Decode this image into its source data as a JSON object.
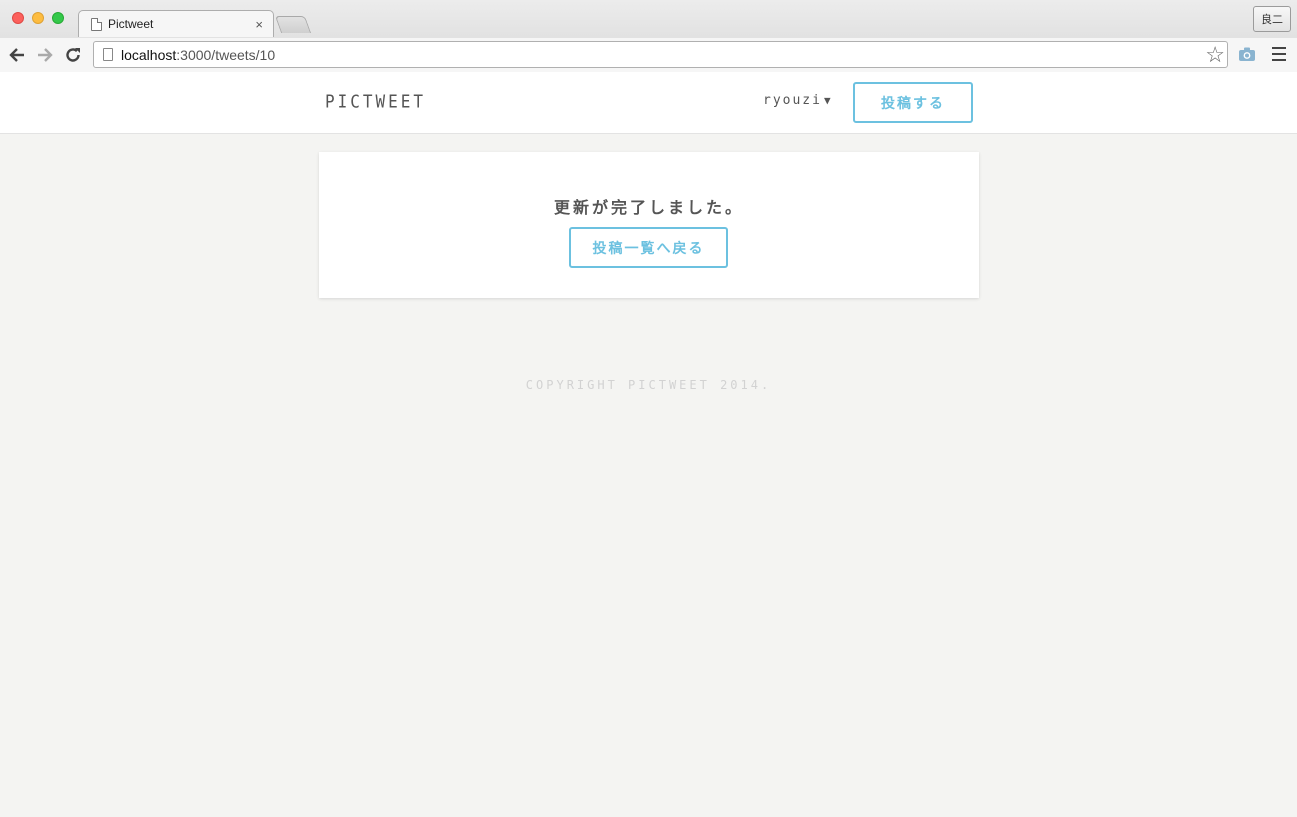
{
  "browser": {
    "tab_title": "Pictweet",
    "tab_close": "×",
    "profile_name": "良二",
    "url_host": "localhost",
    "url_path": ":3000/tweets/10"
  },
  "header": {
    "logo": "PICTWEET",
    "user_name": "ryouzi",
    "user_caret": "▼",
    "post_label": "投稿する"
  },
  "notice": {
    "message": "更新が完了しました。",
    "back_label": "投稿一覧へ戻る"
  },
  "footer": {
    "copyright": "COPYRIGHT PICTWEET 2014."
  },
  "colors": {
    "accent": "#6cc1e0",
    "page_bg": "#f4f4f2",
    "text": "#555555"
  }
}
